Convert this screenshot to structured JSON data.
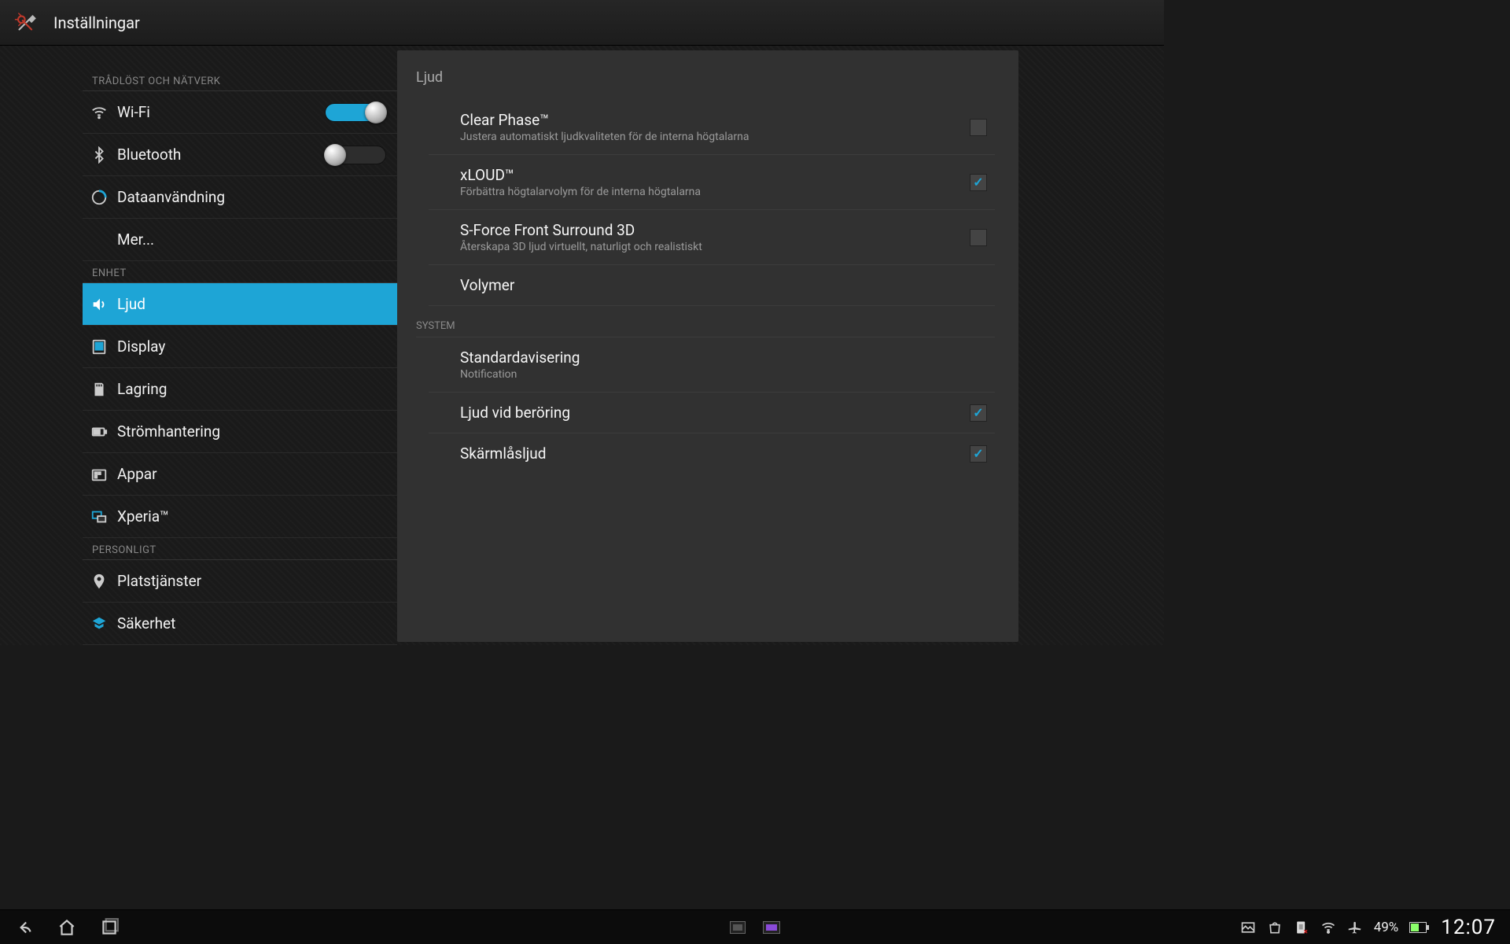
{
  "header": {
    "title": "Inställningar"
  },
  "sidebar": {
    "section_wireless": "TRÅDLÖST OCH NÄTVERK",
    "wifi": "Wi-Fi",
    "bluetooth": "Bluetooth",
    "data_usage": "Dataanvändning",
    "more": "Mer...",
    "section_device": "ENHET",
    "sound": "Ljud",
    "display": "Display",
    "storage": "Lagring",
    "power": "Strömhantering",
    "apps": "Appar",
    "xperia": "Xperia™",
    "section_personal": "PERSONLIGT",
    "location": "Platstjänster",
    "security": "Säkerhet"
  },
  "detail": {
    "title": "Ljud",
    "clear_phase": {
      "title": "Clear Phase™",
      "desc": "Justera automatiskt ljudkvaliteten för de interna högtalarna",
      "checked": false
    },
    "xloud": {
      "title": "xLOUD™",
      "desc": "Förbättra högtalarvolym för de interna högtalarna",
      "checked": true
    },
    "sforce": {
      "title": "S-Force Front Surround 3D",
      "desc": "Återskapa 3D ljud virtuellt, naturligt och realistiskt",
      "checked": false
    },
    "volumes": "Volymer",
    "section_system": "SYSTEM",
    "default_notif": {
      "title": "Standardavisering",
      "desc": "Notification"
    },
    "touch_sounds": {
      "title": "Ljud vid beröring",
      "checked": true
    },
    "lock_sounds": {
      "title": "Skärmlåsljud",
      "checked": true
    }
  },
  "status": {
    "battery_pct": "49%",
    "clock": "12:07"
  }
}
